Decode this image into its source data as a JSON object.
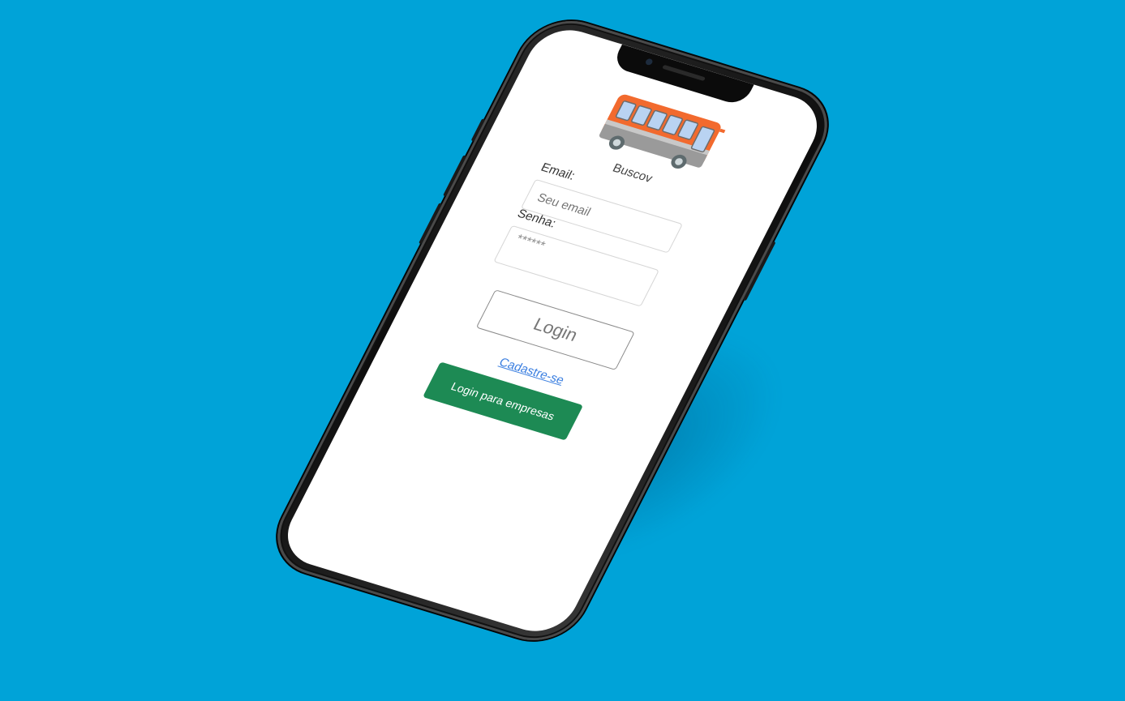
{
  "app": {
    "name": "Buscov"
  },
  "form": {
    "email_label": "Email:",
    "email_placeholder": "Seu email",
    "password_label": "Senha:",
    "password_value": "******"
  },
  "actions": {
    "login_label": "Login",
    "signup_link": "Cadastre-se",
    "business_login_label": "Login para empresas"
  },
  "colors": {
    "background": "#00a3d8",
    "business_button": "#1d8a54",
    "link": "#3b7fe0",
    "bus_body": "#f26a2e",
    "bus_window": "#b9d3f2"
  },
  "icons": {
    "logo": "bus-icon"
  }
}
